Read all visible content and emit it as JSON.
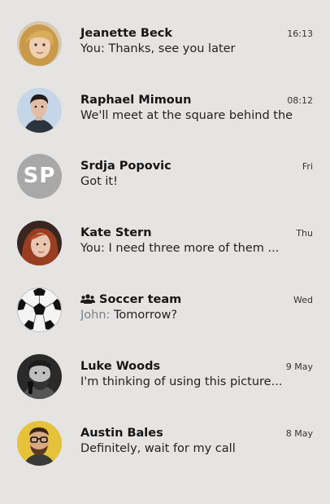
{
  "conversations": [
    {
      "name": "Jeanette Beck",
      "time": "16:13",
      "preview": "You: Thanks, see you later",
      "avatar_icon": "photo-blonde-woman"
    },
    {
      "name": "Raphael Mimoun",
      "time": "08:12",
      "preview": "We'll meet at the square behind the ...",
      "avatar_icon": "photo-man-dark-hair"
    },
    {
      "name": "Srdja Popovic",
      "time": "Fri",
      "preview": "Got it!",
      "avatar_initials": "SP",
      "avatar_color": "#a8a8a8"
    },
    {
      "name": "Kate Stern",
      "time": "Thu",
      "preview": "You: I need three more of them ...",
      "avatar_icon": "photo-red-haired-woman"
    },
    {
      "name": "Soccer team",
      "time": "Wed",
      "preview_sender": "John:",
      "preview": "Tomorrow?",
      "group_icon": "group-icon",
      "avatar_icon": "soccer-ball"
    },
    {
      "name": "Luke Woods",
      "time": "9 May",
      "preview": "I'm thinking of using this picture...",
      "avatar_icon": "photo-bearded-man-microphone"
    },
    {
      "name": "Austin Bales",
      "time": "8 May",
      "preview": "Definitely, wait for my call",
      "avatar_icon": "photo-man-glasses-yellow"
    }
  ],
  "colors": {
    "background": "#e6e4e3",
    "sender_highlight": "#7a8088"
  }
}
